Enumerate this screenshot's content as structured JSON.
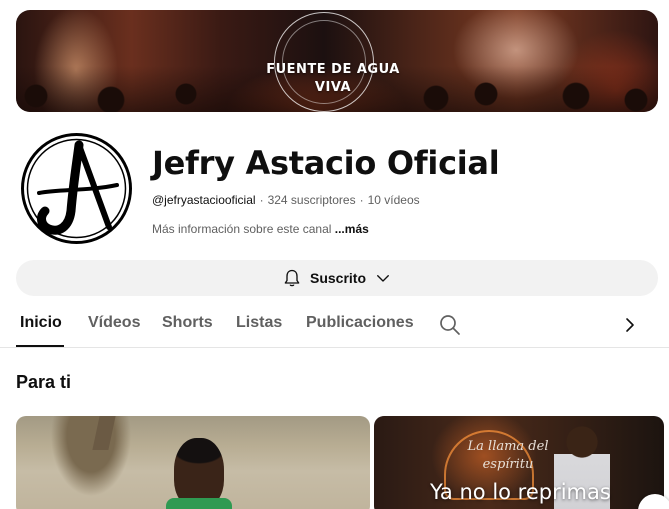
{
  "banner": {
    "line1": "FUENTE DE AGUA",
    "line2": "VIVA"
  },
  "channel": {
    "name": "Jefry Astacio Oficial",
    "handle": "@jefryastaciooficial",
    "subscribers": "324 suscriptores",
    "videos": "10 vídeos",
    "description": "Más información sobre este canal",
    "more": "...más"
  },
  "subscribe": {
    "label": "Suscrito",
    "icon": "bell-icon",
    "dropdown_icon": "chevron-down-icon"
  },
  "tabs": [
    {
      "label": "Inicio",
      "active": true
    },
    {
      "label": "Vídeos",
      "active": false
    },
    {
      "label": "Shorts",
      "active": false
    },
    {
      "label": "Listas",
      "active": false
    },
    {
      "label": "Publicaciones",
      "active": false
    }
  ],
  "tab_icons": {
    "search": "search-icon",
    "next": "chevron-right-icon"
  },
  "section": {
    "title": "Para ti"
  },
  "videos": [
    {
      "thumbnail_text": ""
    },
    {
      "thumbnail_script": "La llama del espíritu",
      "thumbnail_text": "Ya no lo reprimas"
    }
  ]
}
